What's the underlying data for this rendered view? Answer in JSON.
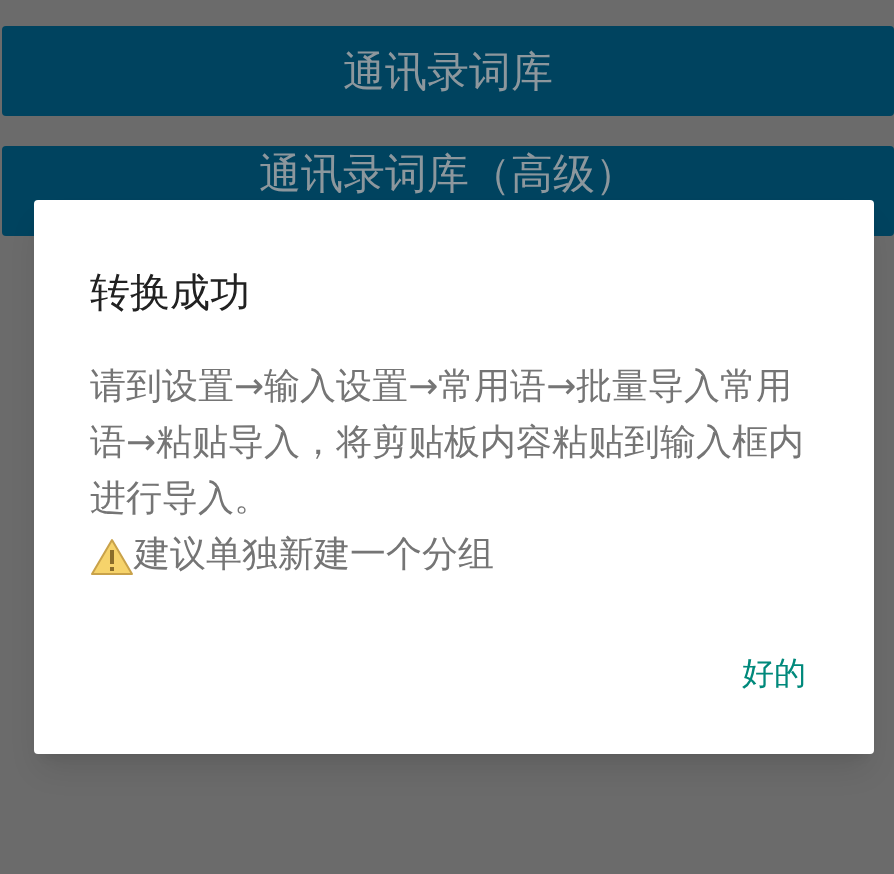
{
  "buttons": [
    {
      "label": "通讯录词库"
    },
    {
      "label": "通讯录词库（高级）"
    }
  ],
  "dialog": {
    "title": "转换成功",
    "message": "请到设置→输入设置→常用语→批量导入常用语→粘贴导入，将剪贴板内容粘贴到输入框内进行导入。",
    "warning": "建议单独新建一个分组",
    "actions": [
      "好的"
    ]
  }
}
